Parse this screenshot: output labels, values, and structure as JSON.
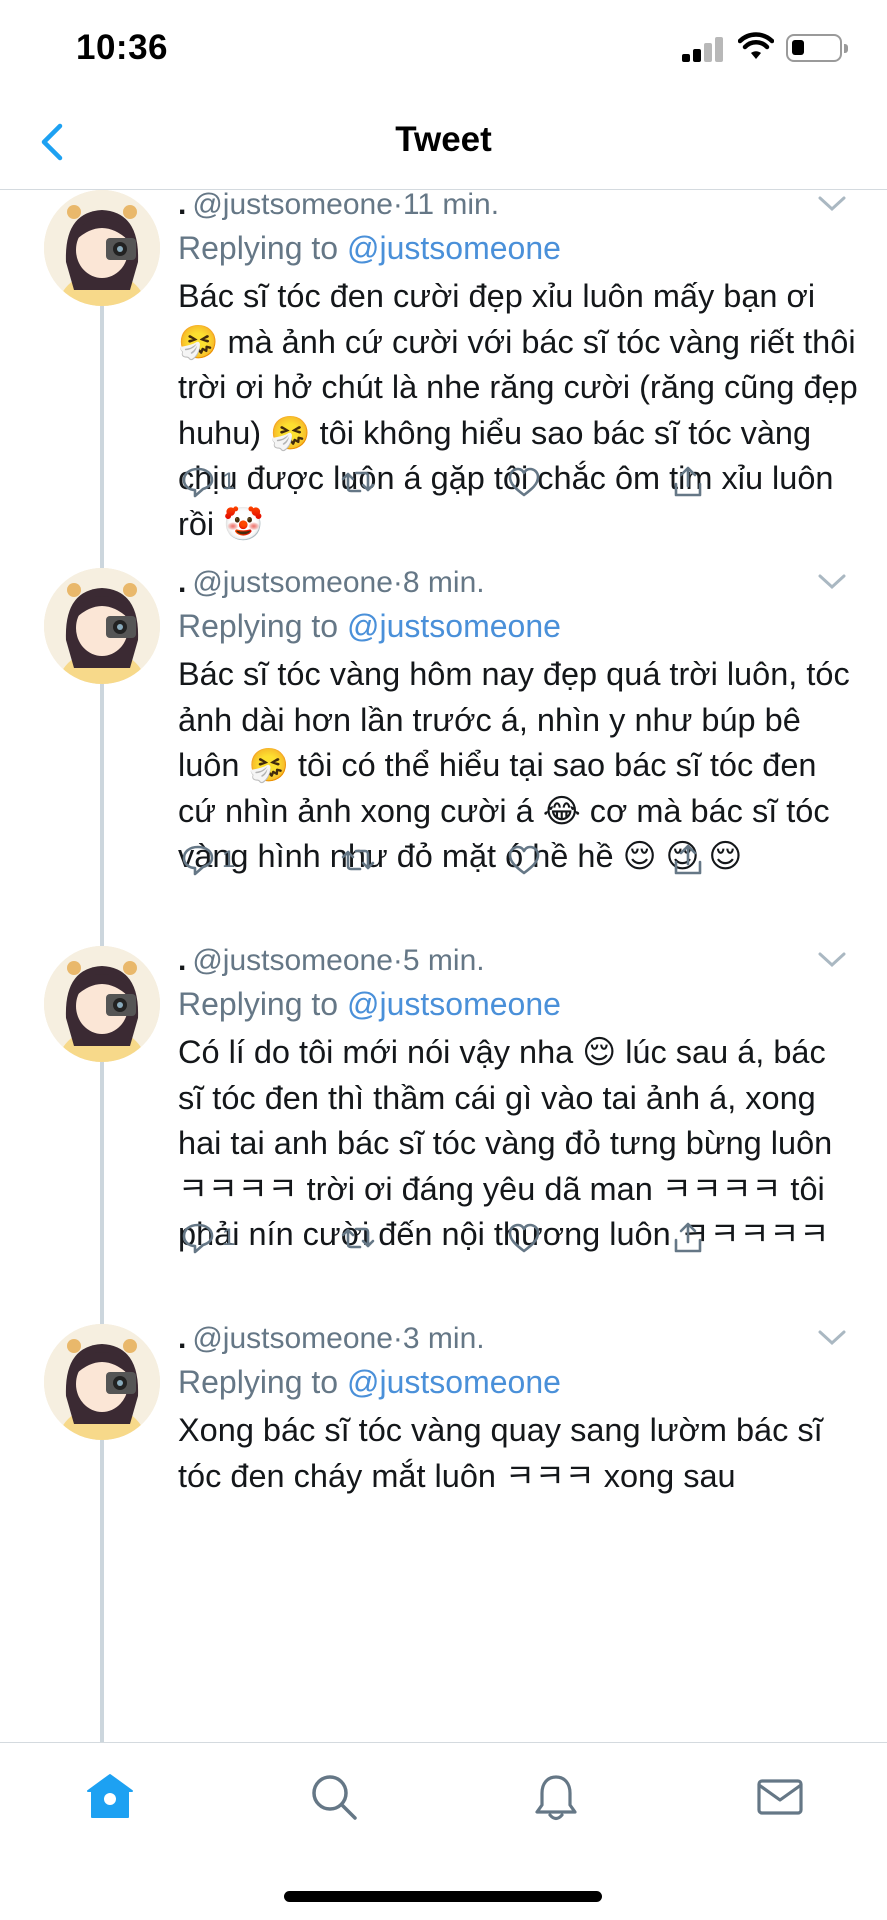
{
  "status_bar": {
    "time": "10:36"
  },
  "header": {
    "title": "Tweet",
    "back_icon": "chevron-left-icon"
  },
  "colors": {
    "accent": "#1DA1F2",
    "mention": "#4A90D9",
    "secondary_text": "#657786",
    "thread_line": "#CCD6DD"
  },
  "tweets": [
    {
      "name": ".",
      "handle": "@justsomeone",
      "separator": "·",
      "time": "11 min.",
      "replying_prefix": "Replying to",
      "replying_to": "@justsomeone",
      "text": "Bác sĩ tóc đen cười đẹp xỉu luôn mấy bạn ơi 🤧 mà ảnh cứ cười với bác sĩ tóc vàng riết thôi trời ơi hở chút là nhe răng cười (răng cũng đẹp huhu) 🤧 tôi không hiểu sao bác sĩ tóc vàng chịu được luôn á gặp tôi chắc ôm tim xỉu luôn rồi 🤡",
      "reply_count": "1"
    },
    {
      "name": ".",
      "handle": "@justsomeone",
      "separator": "·",
      "time": "8 min.",
      "replying_prefix": "Replying to",
      "replying_to": "@justsomeone",
      "text": "Bác sĩ tóc vàng hôm nay đẹp quá trời luôn, tóc ảnh dài hơn lần trước á, nhìn y như búp bê luôn 🤧 tôi có thể hiểu tại sao bác sĩ tóc đen cứ nhìn ảnh xong cười á 😂 cơ mà bác sĩ tóc vàng hình như đỏ mặt ó hề hề 😌 😌 😌",
      "reply_count": "1"
    },
    {
      "name": ".",
      "handle": "@justsomeone",
      "separator": "·",
      "time": "5 min.",
      "replying_prefix": "Replying to",
      "replying_to": "@justsomeone",
      "text": "Có lí do tôi mới nói vậy nha 😌 lúc sau á, bác sĩ tóc đen thì thầm cái gì vào tai ảnh á, xong hai tai anh bác sĩ tóc vàng đỏ tưng bừng luôn ㅋㅋㅋㅋ trời ơi đáng yêu dã man ㅋㅋㅋㅋ tôi phải nín cười đến nội thương luôn ㅋㅋㅋㅋㅋ",
      "reply_count": "1"
    },
    {
      "name": ".",
      "handle": "@justsomeone",
      "separator": "·",
      "time": "3 min.",
      "replying_prefix": "Replying to",
      "replying_to": "@justsomeone",
      "text": "Xong bác sĩ tóc vàng quay sang lườm bác sĩ tóc đen cháy mắt luôn ㅋㅋㅋ xong sau",
      "reply_count": ""
    }
  ],
  "tab_bar": {
    "tabs": [
      "home-icon",
      "search-icon",
      "bell-icon",
      "mail-icon"
    ],
    "active": "home-icon"
  }
}
